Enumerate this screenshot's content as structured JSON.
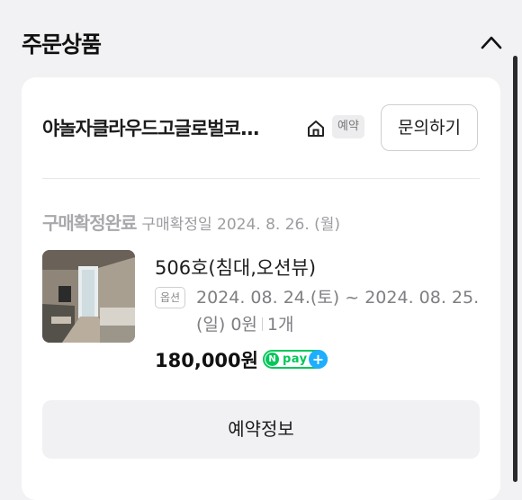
{
  "section": {
    "title": "주문상품",
    "collapse_icon": "chevron-up-icon"
  },
  "order": {
    "store_name": "야놀자클라우드고글로벌코...",
    "store_icon": "home-icon",
    "badge": "예약",
    "inquiry_label": "문의하기",
    "status": "구매확정완료",
    "status_date": "구매확정일 2024. 8. 26. (월)",
    "item": {
      "thumbnail": "hotel-room-photo",
      "name": "506호(침대,오션뷰)",
      "option_badge": "옵션",
      "option_text": "2024. 08. 24.(토) ~ 2024. 08. 25.(일) 0원",
      "quantity": "1개",
      "price": "180,000원",
      "pay_badge": "Npay+",
      "pay_colors": {
        "green": "#03c75a",
        "plus": "#1eaeff"
      }
    },
    "reservation_button": "예약정보"
  }
}
